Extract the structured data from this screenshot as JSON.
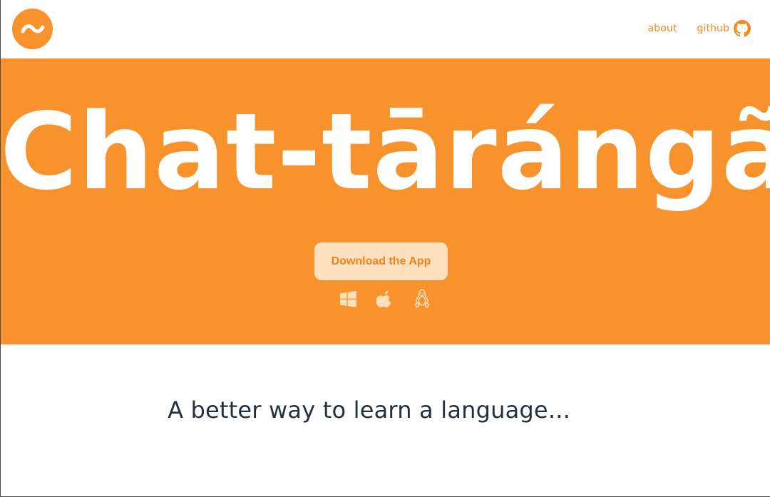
{
  "nav": {
    "about_label": "about",
    "github_label": "github"
  },
  "hero": {
    "title": "Chat-tārángã",
    "download_label": "Download the App",
    "platform_icons": [
      "windows-icon",
      "apple-icon",
      "linux-icon"
    ]
  },
  "tagline": "A better way to learn a language...",
  "colors": {
    "brand_orange": "#f8922d",
    "button_bg": "#fde0bd",
    "button_text": "#f2831c",
    "tagline_text": "#26303b"
  }
}
